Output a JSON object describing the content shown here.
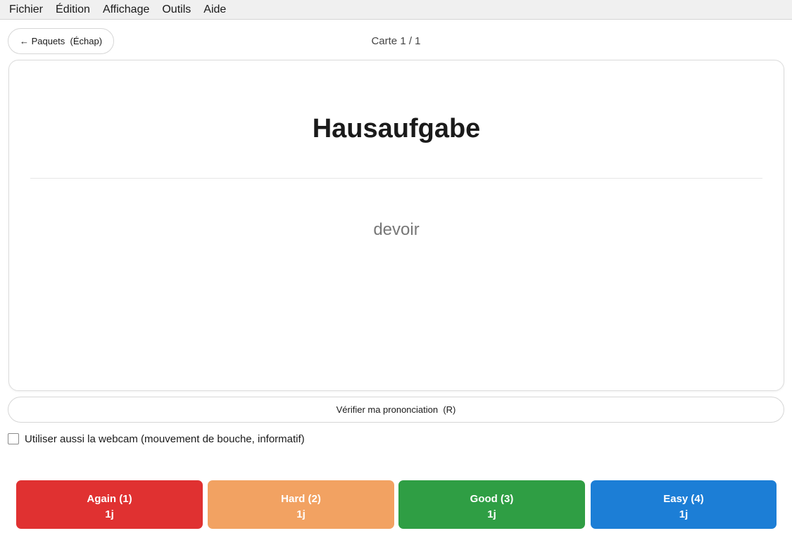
{
  "menubar": {
    "items": [
      "Fichier",
      "Édition",
      "Affichage",
      "Outils",
      "Aide"
    ]
  },
  "header": {
    "back_label": "← Paquets  (Échap)",
    "counter": "Carte 1 / 1"
  },
  "card": {
    "front": "Hausaufgabe",
    "back": "devoir"
  },
  "pronunciation": {
    "label": "Vérifier ma prononciation  (R)"
  },
  "webcam": {
    "label": "Utiliser aussi la webcam (mouvement de bouche, informatif)",
    "checked": false
  },
  "answers": {
    "again": {
      "label": "Again (1)",
      "interval": "1j",
      "color": "#e03131"
    },
    "hard": {
      "label": "Hard (2)",
      "interval": "1j",
      "color": "#f2a262"
    },
    "good": {
      "label": "Good (3)",
      "interval": "1j",
      "color": "#2f9e44"
    },
    "easy": {
      "label": "Easy (4)",
      "interval": "1j",
      "color": "#1c7ed6"
    }
  }
}
